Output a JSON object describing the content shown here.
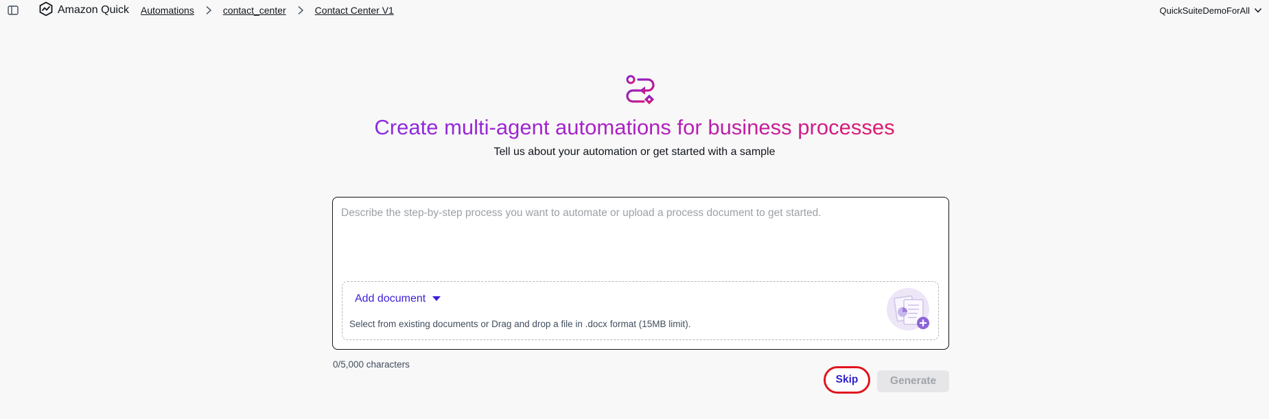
{
  "header": {
    "sidebar_toggle_icon": "sidebar-panel-icon",
    "brand_icon": "quick-logo-icon",
    "brand_name": "Amazon Quick",
    "breadcrumbs": [
      {
        "label": "Automations"
      },
      {
        "label": "contact_center"
      },
      {
        "label": "Contact Center V1"
      }
    ],
    "account_name": "QuickSuiteDemoForAll",
    "account_menu_icon": "chevron-down-icon"
  },
  "main": {
    "hero_icon": "multi-agent-flow-icon",
    "title": "Create multi-agent automations for business processes",
    "subtitle": "Tell us about your automation or get started with a sample",
    "description": {
      "value": "",
      "placeholder": "Describe the step-by-step process you want to automate or upload a process document to get started."
    },
    "dropzone": {
      "add_label": "Add document",
      "add_icon": "caret-down-icon",
      "help_text": "Select from existing documents or Drag and drop a file in .docx format (15MB limit).",
      "illustration_icon": "document-upload-illustration-icon"
    },
    "char_count": "0/5,000 characters",
    "skip_label": "Skip",
    "generate_label": "Generate"
  },
  "colors": {
    "accent": "#2c1fcd",
    "title_gradient_start": "#8a2be2",
    "title_gradient_end": "#e01a6a",
    "highlight_ring": "#e0141e",
    "disabled_bg": "#e6e6e9"
  }
}
